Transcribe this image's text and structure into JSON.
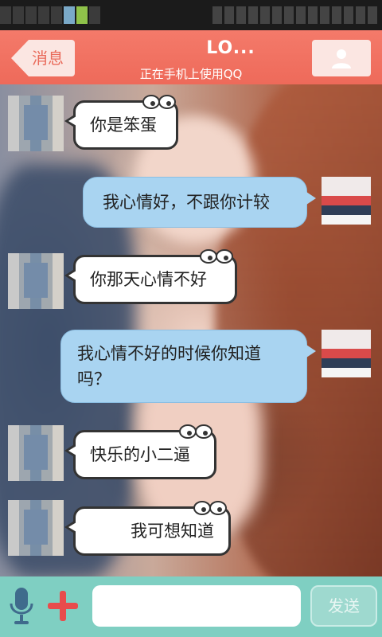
{
  "header": {
    "back_label": "消息",
    "title": "LO...",
    "subtitle": "正在手机上使用QQ"
  },
  "messages": [
    {
      "side": "left",
      "text": "你是笨蛋"
    },
    {
      "side": "right",
      "text": "我心情好，不跟你计较"
    },
    {
      "side": "left",
      "text": "你那天心情不好"
    },
    {
      "side": "right",
      "text": "我心情不好的时候你知道吗？"
    },
    {
      "side": "left",
      "text": "快乐的小二逼"
    },
    {
      "side": "left",
      "text": "我可想知道"
    }
  ],
  "composer": {
    "input_value": "",
    "send_label": "发送"
  },
  "colors": {
    "header": "#ee6a5a",
    "bottom_bar": "#7fcfc2",
    "right_bubble": "#a9d4f1",
    "left_bubble": "#ffffff"
  },
  "icons": [
    "back-arrow-icon",
    "profile-icon",
    "microphone-icon",
    "plus-icon"
  ]
}
